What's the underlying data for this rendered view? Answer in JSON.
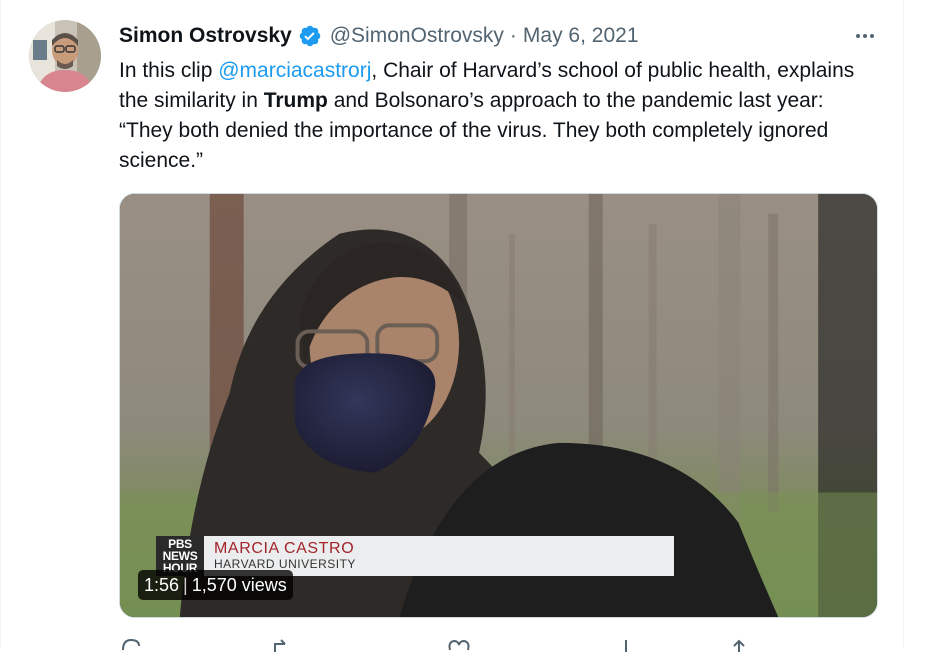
{
  "author": {
    "display_name": "Simon Ostrovsky",
    "handle": "@SimonOstrovsky",
    "separator": "·",
    "date": "May 6, 2021",
    "verified_icon": "verified-badge-icon"
  },
  "tweet": {
    "text_intro": "In this clip ",
    "mention": "@marciacastrorj",
    "text_part2": ", Chair of Harvard’s school of public health, explains the similarity in ",
    "bold_word": "Trump",
    "text_part3": " and Bolsonaro’s approach to the pandemic last year: “They both denied the importance of the virus. They both completely ignored science.”"
  },
  "video": {
    "logo_lines": [
      "PBS",
      "NEWS",
      "HOUR"
    ],
    "caption_name": "MARCIA CASTRO",
    "caption_affiliation": "HARVARD UNIVERSITY",
    "duration": "1:56",
    "meta_separator": "|",
    "views": "1,570 views"
  },
  "icons": {
    "more": "more-options-icon",
    "reply": "reply-icon",
    "retweet": "retweet-icon",
    "like": "like-icon",
    "views": "views-icon",
    "share": "share-icon"
  },
  "colors": {
    "accent": "#1d9bf0",
    "text": "#0f1419",
    "secondary": "#536471",
    "caption_red": "#a3242b"
  }
}
